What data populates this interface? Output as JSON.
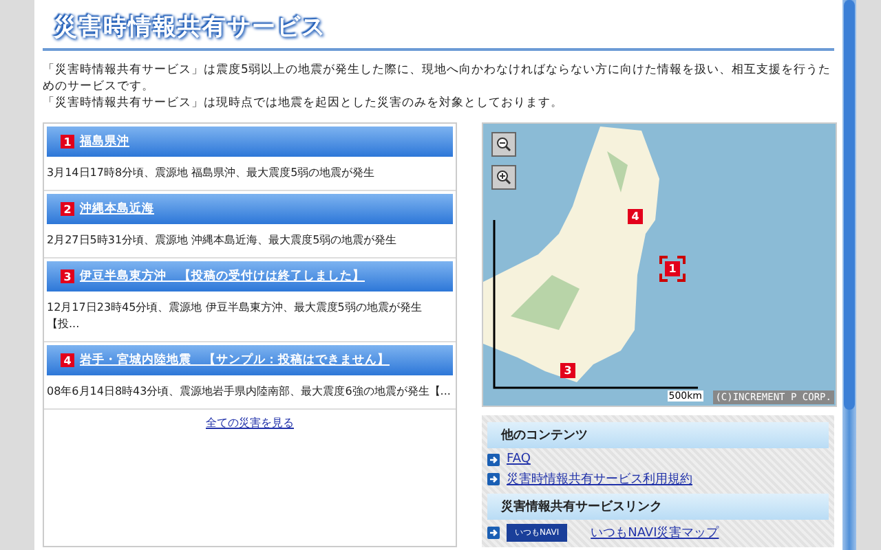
{
  "title": "災害時情報共有サービス",
  "intro": [
    "「災害時情報共有サービス」は震度5弱以上の地震が発生した際に、現地へ向かわなければならない方に向けた情報を扱い、相互支援を行うためのサービスです。",
    "「災害時情報共有サービス」は現時点では地震を起因とした災害のみを対象としております。"
  ],
  "disasters": [
    {
      "number": "1",
      "title": "福島県沖",
      "description": "3月14日17時8分頃、震源地 福島県沖、最大震度5弱の地震が発生"
    },
    {
      "number": "2",
      "title": "沖縄本島近海",
      "description": "2月27日5時31分頃、震源地 沖縄本島近海、最大震度5弱の地震が発生"
    },
    {
      "number": "3",
      "title": "伊豆半島東方沖　【投稿の受付けは終了しました】",
      "description": "12月17日23時45分頃、震源地 伊豆半島東方沖、最大震度5弱の地震が発生【投..."
    },
    {
      "number": "4",
      "title": "岩手・宮城内陸地震　【サンプル：投稿はできません】",
      "description": "08年6月14日8時43分頃、震源地岩手県内陸南部、最大震度6強の地震が発生【..."
    }
  ],
  "all_link": "全ての災害を見る",
  "map": {
    "markers": [
      {
        "number": "4",
        "selected": false
      },
      {
        "number": "1",
        "selected": true
      },
      {
        "number": "3",
        "selected": false
      }
    ],
    "scale": "500km",
    "copyright": "(C)INCREMENT P CORP."
  },
  "sections": [
    {
      "heading": "他のコンテンツ",
      "links": [
        {
          "kind": "plain",
          "label": "FAQ"
        },
        {
          "kind": "plain",
          "label": "災害時情報共有サービス利用規約"
        }
      ]
    },
    {
      "heading": "災害情報共有サービスリンク",
      "links": [
        {
          "kind": "logo",
          "logo": "いつもNAVI",
          "label": "いつもNAVI災害マップ"
        }
      ]
    }
  ]
}
